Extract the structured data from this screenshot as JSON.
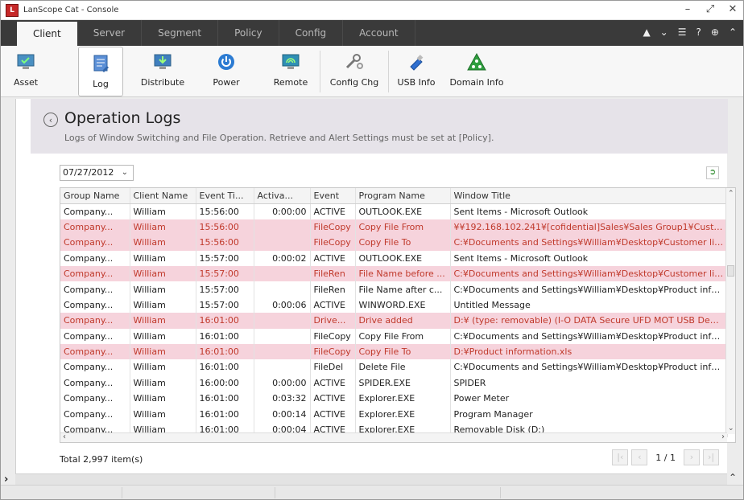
{
  "window": {
    "title": "LanScope Cat - Console",
    "minimize": "–",
    "restore": "⤢",
    "close": "✕"
  },
  "tabs": [
    "Client",
    "Server",
    "Segment",
    "Policy",
    "Config",
    "Account"
  ],
  "tab_tools": {
    "user": "▲",
    "dropdown": "⌄",
    "list": "☰",
    "help": "?",
    "globe": "⊕",
    "collapse": "⌃"
  },
  "toolbar": {
    "asset": "Asset",
    "log": "Log",
    "distribute": "Distribute",
    "power": "Power",
    "remote": "Remote",
    "config_chg": "Config Chg",
    "usb_info": "USB Info",
    "domain_info": "Domain Info"
  },
  "panel": {
    "title": "Operation Logs",
    "description": "Logs of Window Switching and File Operation.  Retrieve and Alert Settings must be set at [Policy]."
  },
  "filter": {
    "date": "07/27/2012"
  },
  "table": {
    "columns": [
      "Group Name",
      "Client Name",
      "Event Ti...",
      "Activa...",
      "Event",
      "Program Name",
      "Window Title"
    ],
    "rows": [
      {
        "alert": false,
        "group": "Company...",
        "client": "William",
        "time": "15:56:00",
        "active": "0:00:00",
        "event": "ACTIVE",
        "program": "OUTLOOK.EXE",
        "title": "Sent Items - Microsoft Outlook"
      },
      {
        "alert": true,
        "group": "Company...",
        "client": "William",
        "time": "15:56:00",
        "active": "",
        "event": "FileCopy",
        "program": "Copy File From",
        "title": "¥¥192.168.102.241¥[cofidential]Sales¥Sales Group1¥Custom..."
      },
      {
        "alert": true,
        "group": "Company...",
        "client": "William",
        "time": "15:56:00",
        "active": "",
        "event": "FileCopy",
        "program": "Copy File To",
        "title": "C:¥Documents and Settings¥William¥Desktop¥Customer list.xls"
      },
      {
        "alert": false,
        "group": "Company...",
        "client": "William",
        "time": "15:57:00",
        "active": "0:00:02",
        "event": "ACTIVE",
        "program": "OUTLOOK.EXE",
        "title": "Sent Items - Microsoft Outlook"
      },
      {
        "alert": true,
        "group": "Company...",
        "client": "William",
        "time": "15:57:00",
        "active": "",
        "event": "FileRen",
        "program": "File Name before ...",
        "title": "C:¥Documents and Settings¥William¥Desktop¥Customer list.xls"
      },
      {
        "alert": false,
        "group": "Company...",
        "client": "William",
        "time": "15:57:00",
        "active": "",
        "event": "FileRen",
        "program": "File Name after c...",
        "title": "C:¥Documents and Settings¥William¥Desktop¥Product inform..."
      },
      {
        "alert": false,
        "group": "Company...",
        "client": "William",
        "time": "15:57:00",
        "active": "0:00:06",
        "event": "ACTIVE",
        "program": "WINWORD.EXE",
        "title": "Untitled Message"
      },
      {
        "alert": true,
        "group": "Company...",
        "client": "William",
        "time": "16:01:00",
        "active": "",
        "event": "Drive...",
        "program": "Drive added",
        "title": "D:¥  (type: removable) (I-O DATA Secure UFD MOT USB Devi..."
      },
      {
        "alert": false,
        "group": "Company...",
        "client": "William",
        "time": "16:01:00",
        "active": "",
        "event": "FileCopy",
        "program": "Copy File From",
        "title": "C:¥Documents and Settings¥William¥Desktop¥Product inform..."
      },
      {
        "alert": true,
        "group": "Company...",
        "client": "William",
        "time": "16:01:00",
        "active": "",
        "event": "FileCopy",
        "program": "Copy File To",
        "title": "D:¥Product information.xls"
      },
      {
        "alert": false,
        "group": "Company...",
        "client": "William",
        "time": "16:01:00",
        "active": "",
        "event": "FileDel",
        "program": "Delete File",
        "title": "C:¥Documents and Settings¥William¥Desktop¥Product inform..."
      },
      {
        "alert": false,
        "group": "Company...",
        "client": "William",
        "time": "16:00:00",
        "active": "0:00:00",
        "event": "ACTIVE",
        "program": "SPIDER.EXE",
        "title": "SPIDER"
      },
      {
        "alert": false,
        "group": "Company...",
        "client": "William",
        "time": "16:01:00",
        "active": "0:03:32",
        "event": "ACTIVE",
        "program": "Explorer.EXE",
        "title": "Power Meter"
      },
      {
        "alert": false,
        "group": "Company...",
        "client": "William",
        "time": "16:01:00",
        "active": "0:00:14",
        "event": "ACTIVE",
        "program": "Explorer.EXE",
        "title": "Program Manager"
      },
      {
        "alert": false,
        "group": "Company...",
        "client": "William",
        "time": "16:01:00",
        "active": "0:00:04",
        "event": "ACTIVE",
        "program": "Explorer.EXE",
        "title": "Removable Disk (D:)"
      }
    ]
  },
  "footer": {
    "total": "Total 2,997 item(s)",
    "page": "1 / 1"
  },
  "colors": {
    "alert_bg": "#f6d3dc",
    "alert_text": "#c0392b",
    "tabbar": "#3a3a3a",
    "header_bg": "#e6e3e9"
  }
}
